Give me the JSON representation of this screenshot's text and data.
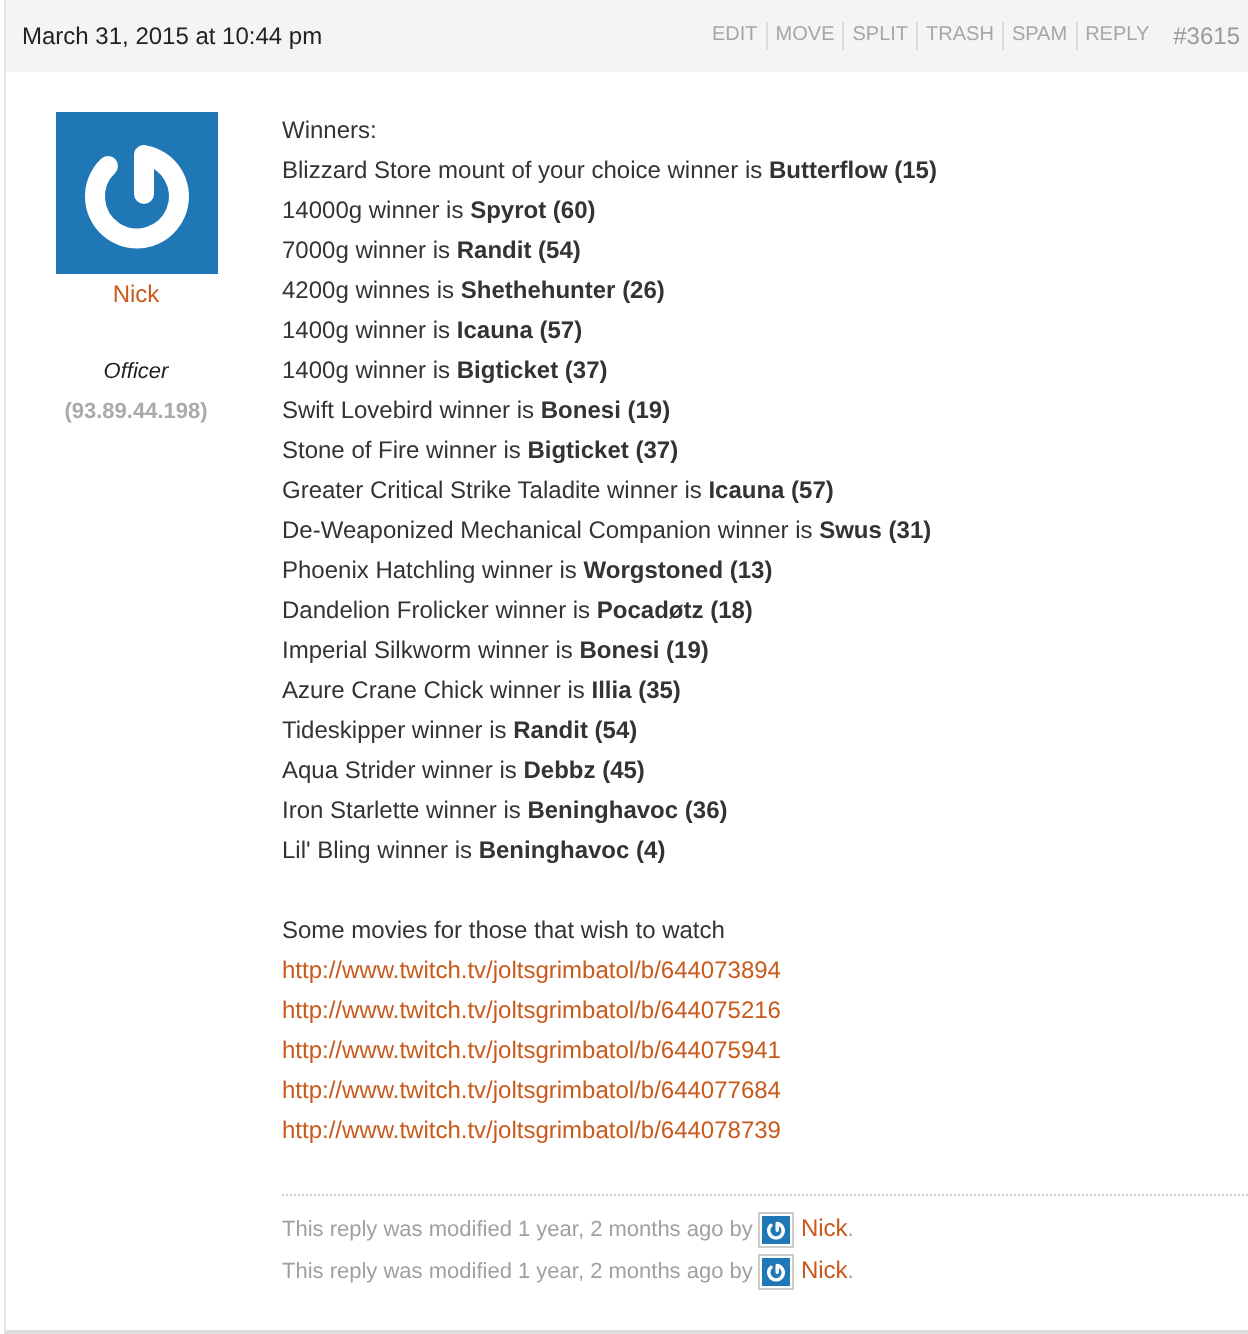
{
  "post_header": {
    "date": "March 31, 2015 at 10:44 pm",
    "actions": [
      "EDIT",
      "MOVE",
      "SPLIT",
      "TRASH",
      "SPAM",
      "REPLY"
    ],
    "post_number": "#3615"
  },
  "author": {
    "name": "Nick",
    "role": "Officer",
    "ip": "(93.89.44.198)"
  },
  "content": {
    "heading": "Winners:",
    "winners": [
      "Blizzard Store mount of your choice winner is **Butterflow (15)**",
      "14000g winner is **Spyrot (60)**",
      "7000g winner is **Randit (54)**",
      "4200g winnes is **Shethehunter (26)**",
      "1400g winner is **Icauna (57)**",
      "1400g winner is **Bigticket (37)**",
      "Swift Lovebird winner is **Bonesi (19)**",
      "Stone of Fire winner is **Bigticket (37)**",
      "Greater Critical Strike Taladite winner is **Icauna (57)**",
      "De-Weaponized Mechanical Companion winner is **Swus (31)**",
      "Phoenix Hatchling winner is **Worgstoned (13)**",
      "Dandelion Frolicker winner is **Pocadøtz (18)**",
      "Imperial Silkworm winner is **Bonesi (19)**",
      "Azure Crane Chick winner is **Illia (35)**",
      "Tideskipper winner is **Randit (54)**",
      "Aqua Strider winner is **Debbz (45)**",
      "Iron Starlette winner is **Beninghavoc (36)**",
      "Lil' Bling winner is **Beninghavoc (4)**"
    ],
    "intro": "Some movies for those that wish to watch",
    "links": [
      "http://www.twitch.tv/joltsgrimbatol/b/644073894",
      "http://www.twitch.tv/joltsgrimbatol/b/644075216",
      "http://www.twitch.tv/joltsgrimbatol/b/644075941",
      "http://www.twitch.tv/joltsgrimbatol/b/644077684",
      "http://www.twitch.tv/joltsgrimbatol/b/644078739"
    ]
  },
  "revisions": [
    {
      "text": "This reply was modified 1 year, 2 months ago by",
      "author": "Nick",
      "end": "."
    },
    {
      "text": "This reply was modified 1 year, 2 months ago by",
      "author": "Nick",
      "end": "."
    }
  ]
}
